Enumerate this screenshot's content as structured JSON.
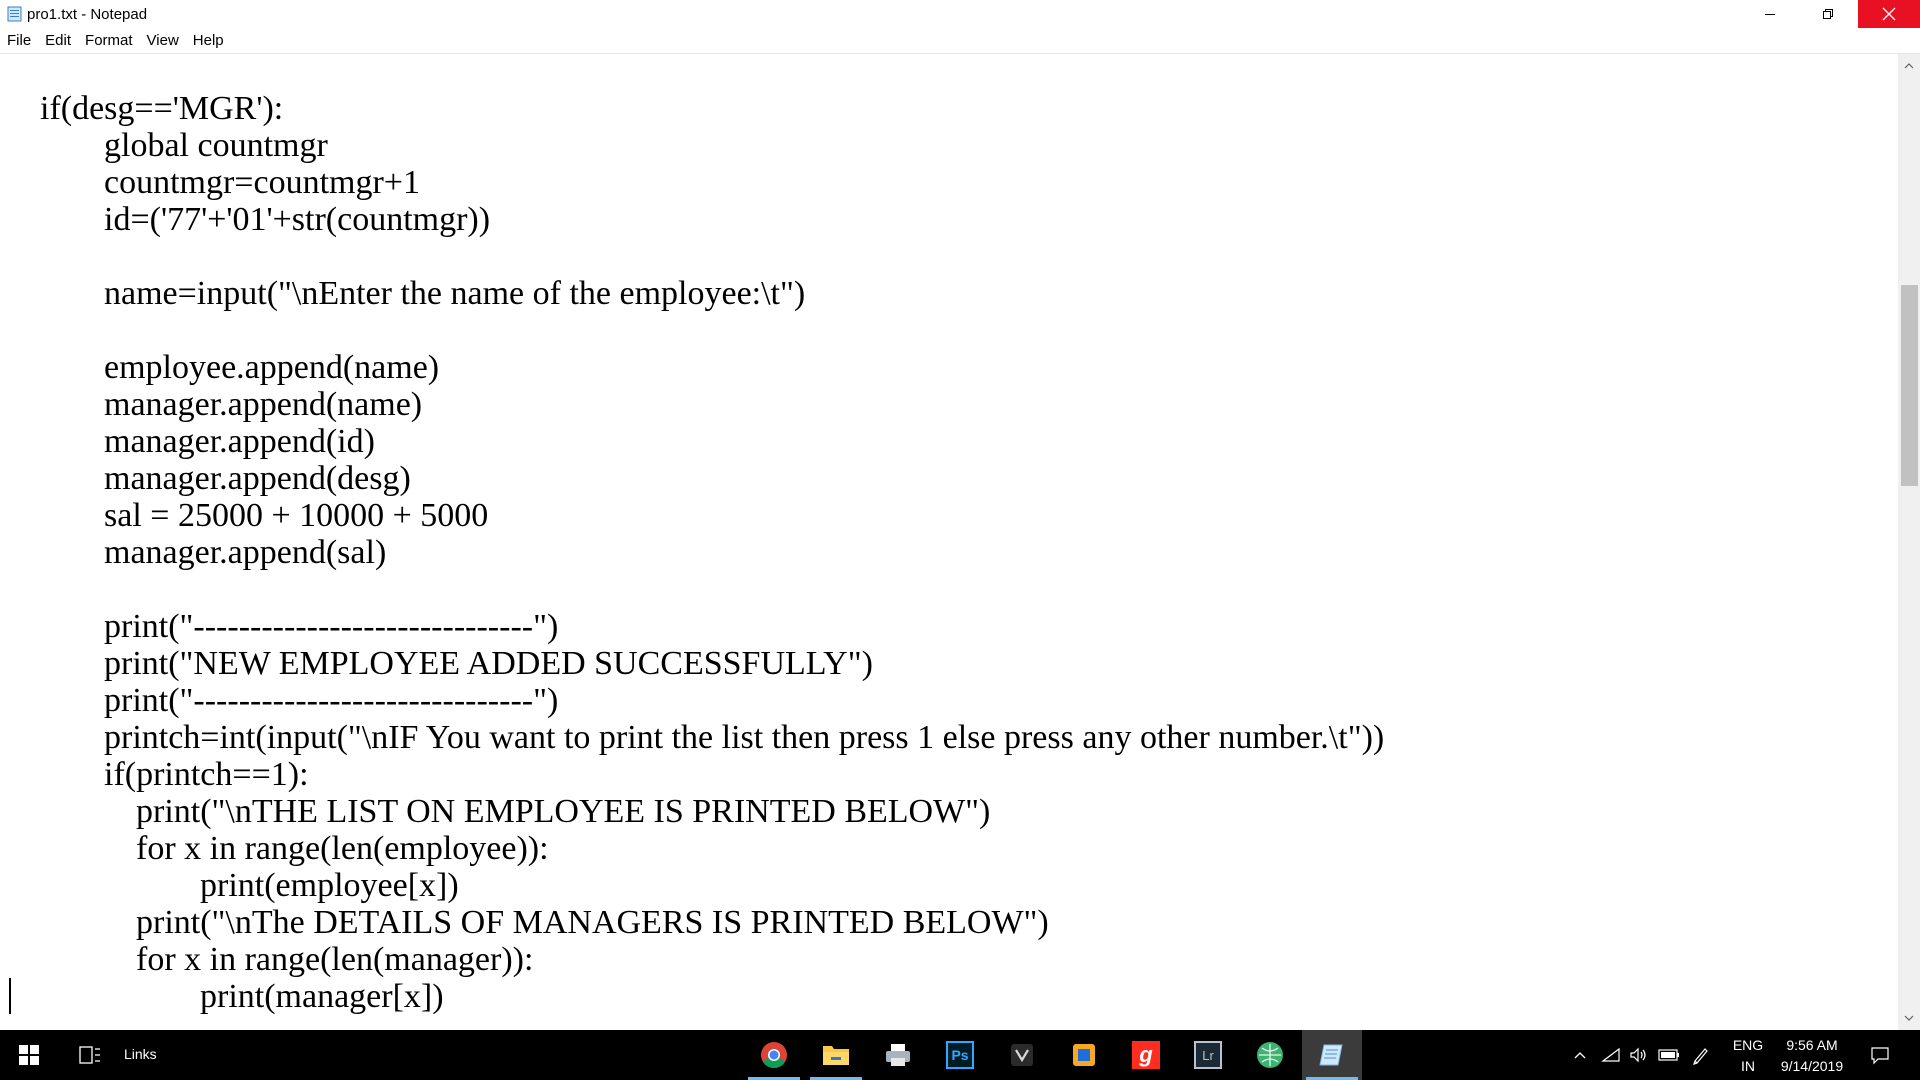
{
  "window": {
    "title": "pro1.txt - Notepad",
    "close_color": "#e81123"
  },
  "menu": [
    {
      "label": "File"
    },
    {
      "label": "Edit"
    },
    {
      "label": "Format"
    },
    {
      "label": "View"
    },
    {
      "label": "Help"
    }
  ],
  "editor": {
    "lines": [
      "if(desg=='MGR'):",
      "global countmgr",
      "countmgr=countmgr+1",
      "id=('77'+'01'+str(countmgr))",
      "name=input(\"\\nEnter the name of the employee:\\t\")",
      "employee.append(name)",
      "manager.append(name)",
      "manager.append(id)",
      "manager.append(desg)",
      "sal = 25000 + 10000 + 5000",
      "manager.append(sal)",
      "print(\"------------------------------\")",
      "print(\"NEW EMPLOYEE ADDED SUCCESSFULLY\")",
      "print(\"------------------------------\")",
      "printch=int(input(\"\\nIF You want to print the list then press 1 else press any other number.\\t\"))",
      "if(printch==1):",
      "print(\"\\nTHE LIST ON EMPLOYEE IS PRINTED BELOW\")",
      "for x in range(len(employee)):",
      "print(employee[x])",
      "print(\"\\nThe DETAILS OF MANAGERS IS PRINTED BELOW\")",
      "for x in range(len(manager)):",
      "print(manager[x])"
    ]
  },
  "taskbar": {
    "links_label": "Links",
    "apps": [
      {
        "icon": "chrome-icon"
      },
      {
        "icon": "file-explorer-icon"
      },
      {
        "icon": "printer-icon"
      },
      {
        "icon": "photoshop-icon",
        "text": "Ps",
        "color": "#31a8ff"
      },
      {
        "icon": "vpn-icon"
      },
      {
        "icon": "office-icon"
      },
      {
        "icon": "g-app-icon",
        "text": "g",
        "color": "#ff2d20"
      },
      {
        "icon": "lightroom-icon",
        "text": "Lr",
        "color": "#b7c4cf"
      },
      {
        "icon": "globe-app-icon"
      },
      {
        "icon": "notepad-icon"
      }
    ],
    "lang_top": "ENG",
    "lang_bottom": "IN",
    "time": "9:56 AM",
    "date": "9/14/2019"
  }
}
